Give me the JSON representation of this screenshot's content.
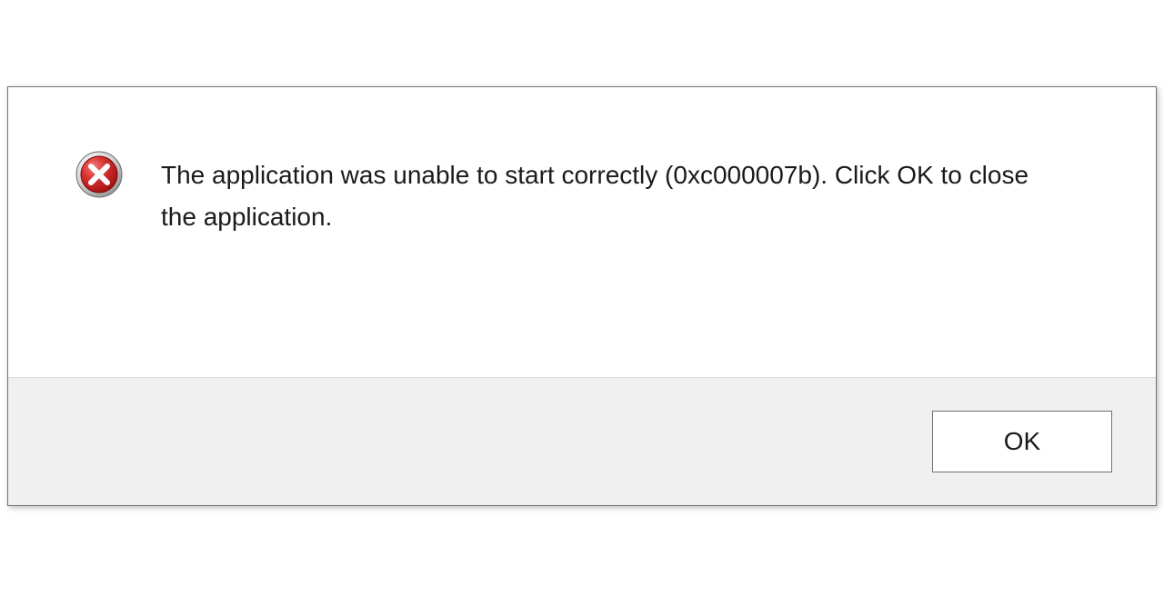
{
  "dialog": {
    "icon": "error-icon",
    "message": "The application was unable to start correctly (0xc000007b). Click OK to close the application.",
    "buttons": {
      "ok": "OK"
    }
  }
}
